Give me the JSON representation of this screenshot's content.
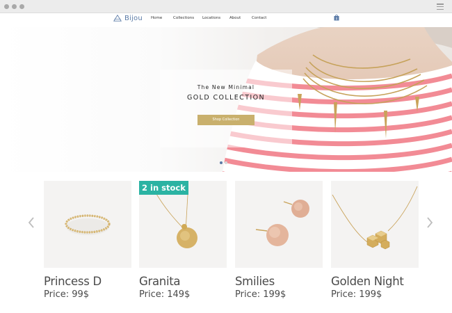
{
  "browser": {
    "menu_icon": "hamburger-icon"
  },
  "header": {
    "logo_text": "Bijou",
    "logo_icon": "triangle-logo-icon",
    "nav": [
      {
        "label": "Home",
        "active": true
      },
      {
        "label": "Collections",
        "active": false
      },
      {
        "label": "Locations",
        "active": false
      },
      {
        "label": "About",
        "active": false
      },
      {
        "label": "Contact",
        "active": false
      }
    ],
    "cart_icon": "shopping-bag-icon",
    "cart_count": "0"
  },
  "hero": {
    "subtitle": "The New Minimal",
    "title": "GOLD COLLECTION",
    "button_label": "Shop Collection",
    "slides_total": 2,
    "active_slide": 1
  },
  "products": [
    {
      "name": "Princess D",
      "price": "Price: 99$",
      "badge": ""
    },
    {
      "name": "Granita",
      "price": "Price: 149$",
      "badge": "2 in stock"
    },
    {
      "name": "Smilies",
      "price": "Price:  199$",
      "badge": ""
    },
    {
      "name": "Golden Night",
      "price": "Price:  199$",
      "badge": ""
    }
  ],
  "carousel": {
    "prev_icon": "chevron-left-icon",
    "next_icon": "chevron-right-icon"
  },
  "colors": {
    "accent": "#5a7aa6",
    "gold": "#c9b06d",
    "badge": "#2bb3a3",
    "stripe": "#f28b95"
  }
}
